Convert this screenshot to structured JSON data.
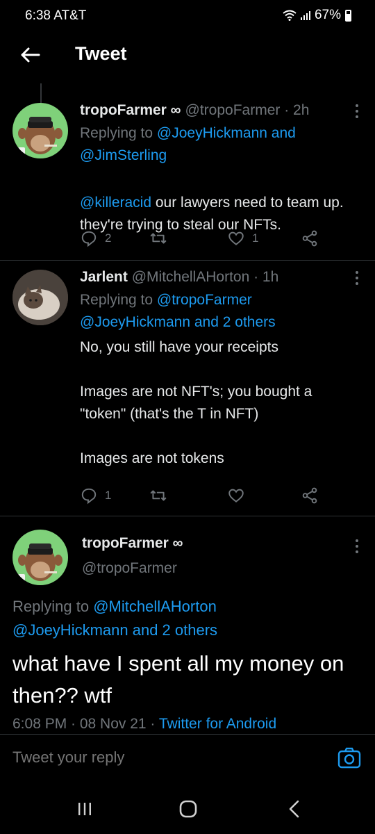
{
  "status_bar": {
    "time": "6:38 AT&T",
    "battery": "67%"
  },
  "header": {
    "title": "Tweet"
  },
  "tweets": [
    {
      "name": "tropoFarmer ∞",
      "handle": "@tropoFarmer",
      "time": "· 2h",
      "replying_prefix": "Replying to ",
      "replying_to": "@JoeyHickmann and @JimSterling",
      "mention": "@killeracid",
      "text": " our lawyers need to team up. they're trying to steal our NFTs.",
      "reply_count": "2",
      "retweet_count": "",
      "like_count": "1"
    },
    {
      "name": "Jarlent",
      "handle": "@MitchellAHorton",
      "time": "· 1h",
      "replying_prefix": "Replying to ",
      "replying_to": "@tropoFarmer @JoeyHickmann and 2 others",
      "text": "No, you still have your receipts\n\nImages are not NFT's; you bought a \"token\" (that's the T in NFT)\n\nImages are not tokens",
      "reply_count": "1",
      "retweet_count": "",
      "like_count": ""
    }
  ],
  "focus_tweet": {
    "name": "tropoFarmer ∞",
    "handle": "@tropoFarmer",
    "replying_prefix": "Replying to ",
    "replying_to_line1": "@MitchellAHorton",
    "replying_to_line2": "@JoeyHickmann and 2 others",
    "text": "what have I spent all my money on then?? wtf",
    "timestamp": "6:08 PM · 08 Nov 21 · ",
    "source": "Twitter for Android"
  },
  "reply_bar": {
    "placeholder": "Tweet your reply"
  },
  "icons": {
    "back": "arrow-left-icon",
    "reply": "reply-icon",
    "retweet": "retweet-icon",
    "like": "heart-icon",
    "share": "share-icon",
    "camera": "camera-icon"
  },
  "colors": {
    "accent": "#1d9bf0",
    "muted": "#71767b",
    "background": "#000000"
  }
}
